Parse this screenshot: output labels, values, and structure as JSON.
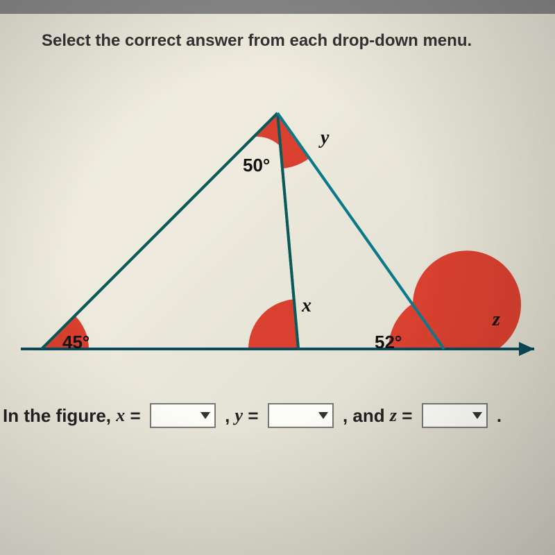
{
  "instruction": "Select the correct answer from each drop-down menu.",
  "figure": {
    "angle_left": "45°",
    "angle_top": "50°",
    "angle_bottom_right_inner": "52°",
    "var_x": "x",
    "var_y": "y",
    "var_z": "z"
  },
  "answer": {
    "prefix": "In the figure, ",
    "var_x": "x",
    "eq_x": " = ",
    "comma1": " , ",
    "var_y": "y",
    "eq_y": " = ",
    "comma2": " , and ",
    "var_z": "z",
    "eq_z": " = ",
    "period": " ."
  }
}
